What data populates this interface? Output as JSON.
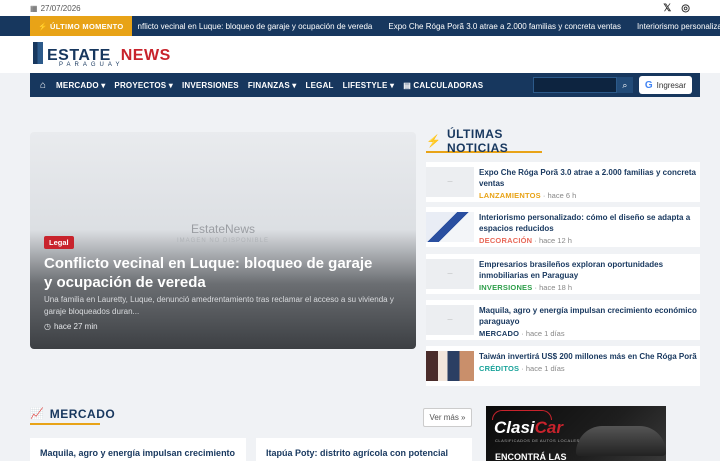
{
  "topbar": {
    "date": "27/07/2026",
    "social": [
      "x-icon",
      "instagram-icon"
    ]
  },
  "breaking": {
    "label": "ÚLTIMO MOMENTO",
    "items": [
      "nflicto vecinal en Luque: bloqueo de garaje y ocupación de vereda",
      "Expo Che Róga Porã 3.0 atrae a 2.000 familias y concreta ventas",
      "Interiorismo personalizado"
    ]
  },
  "logo": {
    "word1": "ESTATE",
    "word2": "NEWS",
    "sub": "PARAGUAY"
  },
  "nav": {
    "items": [
      "MERCADO ▾",
      "PROYECTOS ▾",
      "INVERSIONES",
      "FINANZAS ▾",
      "LEGAL",
      "LIFESTYLE ▾",
      "CALCULADORAS"
    ],
    "login_label": "Ingresar"
  },
  "hero": {
    "watermark": "EstateNews",
    "watermark_sub": "IMAGEN NO DISPONIBLE",
    "category": "Legal",
    "title": "Conflicto vecinal en Luque: bloqueo de garaje y ocupación de vereda",
    "excerpt": "Una familia en Lauretty, Luque, denunció amedrentamiento tras reclamar el acceso a su vivienda y garaje bloqueados duran...",
    "time": "hace 27 min"
  },
  "latest": {
    "heading": "ÚLTIMAS NOTICIAS",
    "items": [
      {
        "title": "Expo Che Róga Porã 3.0 atrae a 2.000 familias y concreta ventas",
        "category": "LANZAMIENTOS",
        "time": "hace 6 h",
        "color": "#e8a317"
      },
      {
        "title": "Interiorismo personalizado: cómo el diseño se adapta a espacios reducidos",
        "category": "DECORACIÓN",
        "time": "hace 12 h",
        "color": "#e86a5a"
      },
      {
        "title": "Empresarios brasileños exploran oportunidades inmobiliarias en Paraguay",
        "category": "INVERSIONES",
        "time": "hace 18 h",
        "color": "#2e9e4a"
      },
      {
        "title": "Maquila, agro y energía impulsan crecimiento económico paraguayo",
        "category": "MERCADO",
        "time": "hace 1 días",
        "color": "#17375e"
      },
      {
        "title": "Taiwán invertirá US$ 200 millones más en Che Róga Porã",
        "category": "CRÉDITOS",
        "time": "hace 1 días",
        "color": "#1aa39a"
      }
    ]
  },
  "mercado": {
    "heading": "MERCADO",
    "see_more": "Ver más »",
    "cards": [
      "Maquila, agro y energía impulsan crecimiento",
      "Itapúa Poty: distrito agrícola con potencial"
    ]
  },
  "ad": {
    "brand_a": "Clasi",
    "brand_b": "Car",
    "tagline": "CLASIFICADOS DE AUTOS LOCALES",
    "cta": "ENCONTRÁ LAS"
  }
}
